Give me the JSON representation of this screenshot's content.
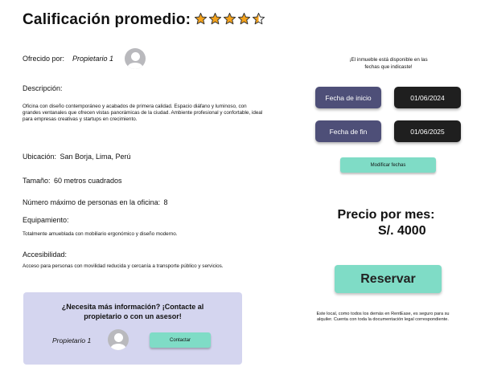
{
  "header": {
    "title": "Calificación promedio:",
    "rating": 4.5,
    "star_color": "#f4a21b"
  },
  "owner": {
    "label": "Ofrecido por:",
    "name": "Propietario 1",
    "avatar_icon": "user-avatar-icon"
  },
  "description": {
    "label": "Descripción:",
    "text": "Oficina con diseño contemporáneo y acabados de primera calidad. Espacio diáfano y luminoso, con grandes ventanales que ofrecen vistas panorámicas de la ciudad. Ambiente profesional y  confortable, ideal para empresas creativas y startups en crecimiento."
  },
  "location": {
    "label": "Ubicación:",
    "value": "San Borja, Lima, Perú"
  },
  "size": {
    "label": "Tamaño:",
    "value": "60 metros cuadrados"
  },
  "capacity": {
    "label": "Número máximo de personas en la oficina:",
    "value": "8"
  },
  "equipment": {
    "label": "Equipamiento:",
    "text": "Totalmente amueblada con mobiliario ergonómico y diseño moderno."
  },
  "accessibility": {
    "label": "Accesibilidad:",
    "text": "Acceso para personas con movilidad reducida y cercanía a transporte público y servicios."
  },
  "contact_panel": {
    "title": "¿Necesita más información? ¡Contacte al propietario o con un asesor!",
    "owner_name": "Propietario 1",
    "button_label": "Contactar",
    "background": "#d4d5ef"
  },
  "availability": {
    "message": "¡El inmueble está disponible en las fechas que indicaste!",
    "start_label": "Fecha de inicio",
    "start_value": "01/06/2024",
    "end_label": "Fecha de fin",
    "end_value": "01/06/2025",
    "modify_label": "Modificar fechas"
  },
  "pricing": {
    "label": "Precio por mes:",
    "value": "S/. 4000",
    "reserve_label": "Reservar",
    "legal": "Este local, como todos los demás en RentEase, es seguro para su alquiler. Cuenta con toda la documentación legal correspondiente."
  },
  "colors": {
    "accent": "#7fdcc6",
    "date_label_bg": "#4e4f78",
    "date_value_bg": "#1f1f1f"
  }
}
